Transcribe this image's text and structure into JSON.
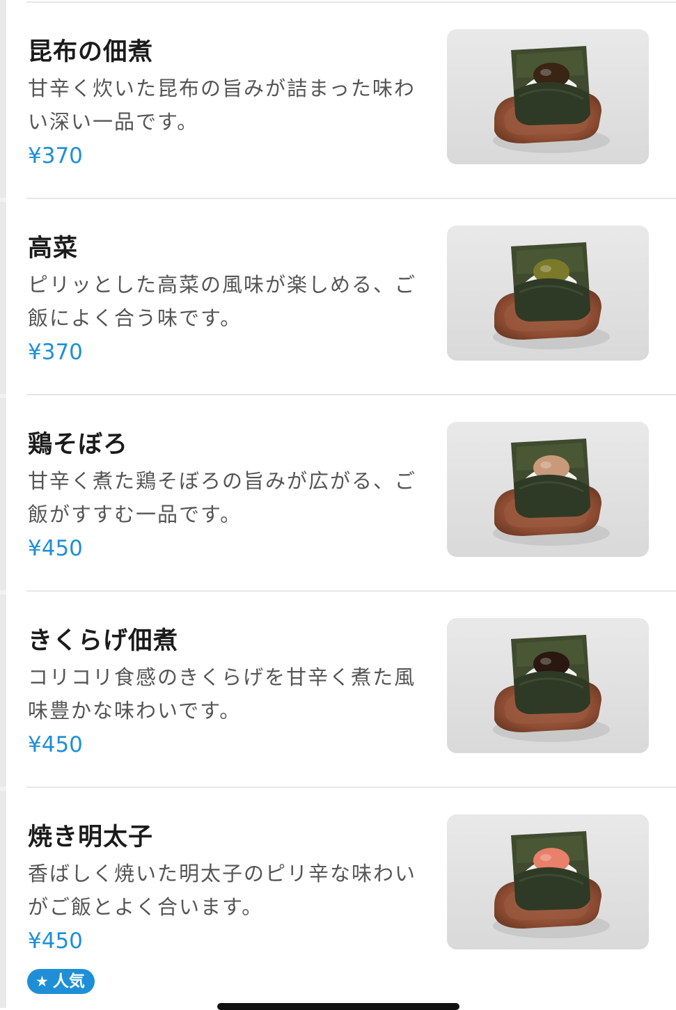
{
  "menu": {
    "items": [
      {
        "name": "昆布の佃煮",
        "description": "甘辛く炊いた昆布の旨みが詰まった味わい深い一品です。",
        "price": "¥370",
        "photo": "konbu-onigiri",
        "filling_color": "#3a2414"
      },
      {
        "name": "高菜",
        "description": "ピリッとした高菜の風味が楽しめる、ご飯によく合う味です。",
        "price": "¥370",
        "photo": "takana-onigiri",
        "filling_color": "#7a7a2a"
      },
      {
        "name": "鶏そぼろ",
        "description": "甘辛く煮た鶏そぼろの旨みが広がる、ご飯がすすむ一品です。",
        "price": "¥450",
        "photo": "tori-soboro-onigiri",
        "filling_color": "#c99a7a"
      },
      {
        "name": "きくらげ佃煮",
        "description": "コリコリ食感のきくらげを甘辛く煮た風味豊かな味わいです。",
        "price": "¥450",
        "photo": "kikurage-onigiri",
        "filling_color": "#2a1810"
      },
      {
        "name": "焼き明太子",
        "description": "香ばしく焼いた明太子のピリ辛な味わいがご飯とよく合います。",
        "price": "¥450",
        "photo": "yaki-mentaiko-onigiri",
        "filling_color": "#e8806a",
        "badge": {
          "icon": "star-icon",
          "label": "人気"
        }
      }
    ]
  },
  "colors": {
    "price": "#1e8fd6",
    "badge_bg": "#1e8fd6",
    "name": "#1b1b1b",
    "description": "#555555"
  }
}
